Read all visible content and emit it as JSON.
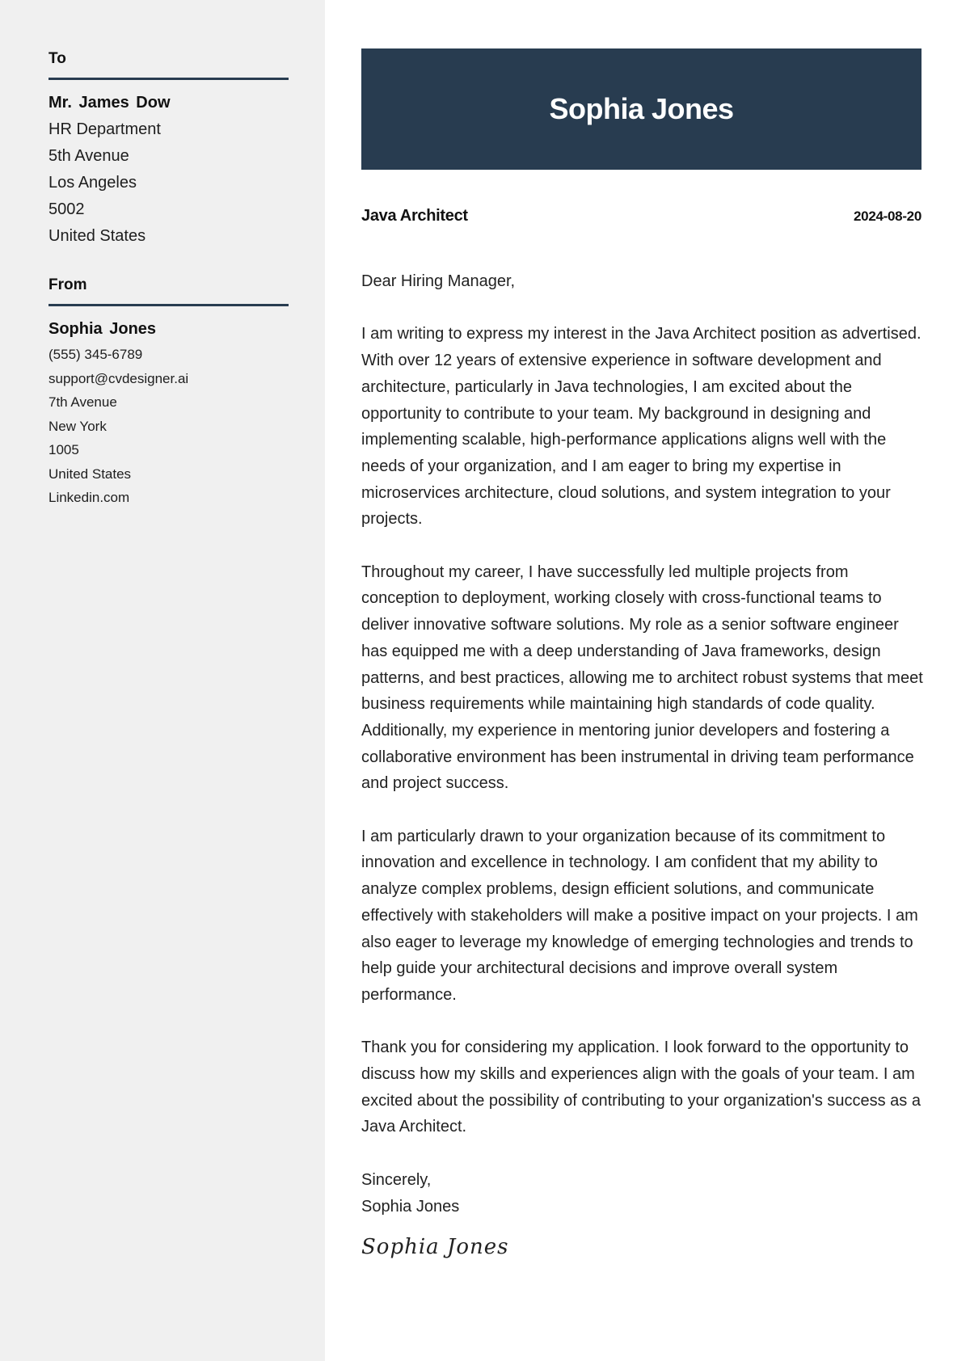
{
  "sidebar": {
    "to": {
      "heading": "To",
      "name": "Mr. James Dow",
      "lines": [
        "HR Department",
        "5th Avenue",
        "Los Angeles",
        "5002",
        "United States"
      ]
    },
    "from": {
      "heading": "From",
      "name": "Sophia Jones",
      "lines": [
        "(555) 345-6789",
        "support@cvdesigner.ai",
        "7th Avenue",
        "New York",
        "1005",
        "United States",
        "Linkedin.com"
      ]
    }
  },
  "header": {
    "name": "Sophia Jones"
  },
  "meta": {
    "job_title": "Java Architect",
    "date": "2024-08-20"
  },
  "letter": {
    "salutation": "Dear Hiring Manager,",
    "paragraphs": [
      "I am writing to express my interest in the Java Architect position as advertised. With over 12 years of extensive experience in software development and architecture, particularly in Java technologies, I am excited about the opportunity to contribute to your team. My background in designing and implementing scalable, high-performance applications aligns well with the needs of your organization, and I am eager to bring my expertise in microservices architecture, cloud solutions, and system integration to your projects.",
      "Throughout my career, I have successfully led multiple projects from conception to deployment, working closely with cross-functional teams to deliver innovative software solutions. My role as a senior software engineer has equipped me with a deep understanding of Java frameworks, design patterns, and best practices, allowing me to architect robust systems that meet business requirements while maintaining high standards of code quality. Additionally, my experience in mentoring junior developers and fostering a collaborative environment has been instrumental in driving team performance and project success.",
      "I am particularly drawn to your organization because of its commitment to innovation and excellence in technology. I am confident that my ability to analyze complex problems, design efficient solutions, and communicate effectively with stakeholders will make a positive impact on your projects. I am also eager to leverage my knowledge of emerging technologies and trends to help guide your architectural decisions and improve overall system performance.",
      "Thank you for considering my application. I look forward to the opportunity to discuss how my skills and experiences align with the goals of your team. I am excited about the possibility of contributing to your organization's success as a Java Architect."
    ],
    "closing": "Sincerely,",
    "closing_name": "Sophia Jones",
    "signature": "Sophia Jones"
  },
  "colors": {
    "accent": "#283c50",
    "sidebar_bg": "#f0f0f0"
  }
}
